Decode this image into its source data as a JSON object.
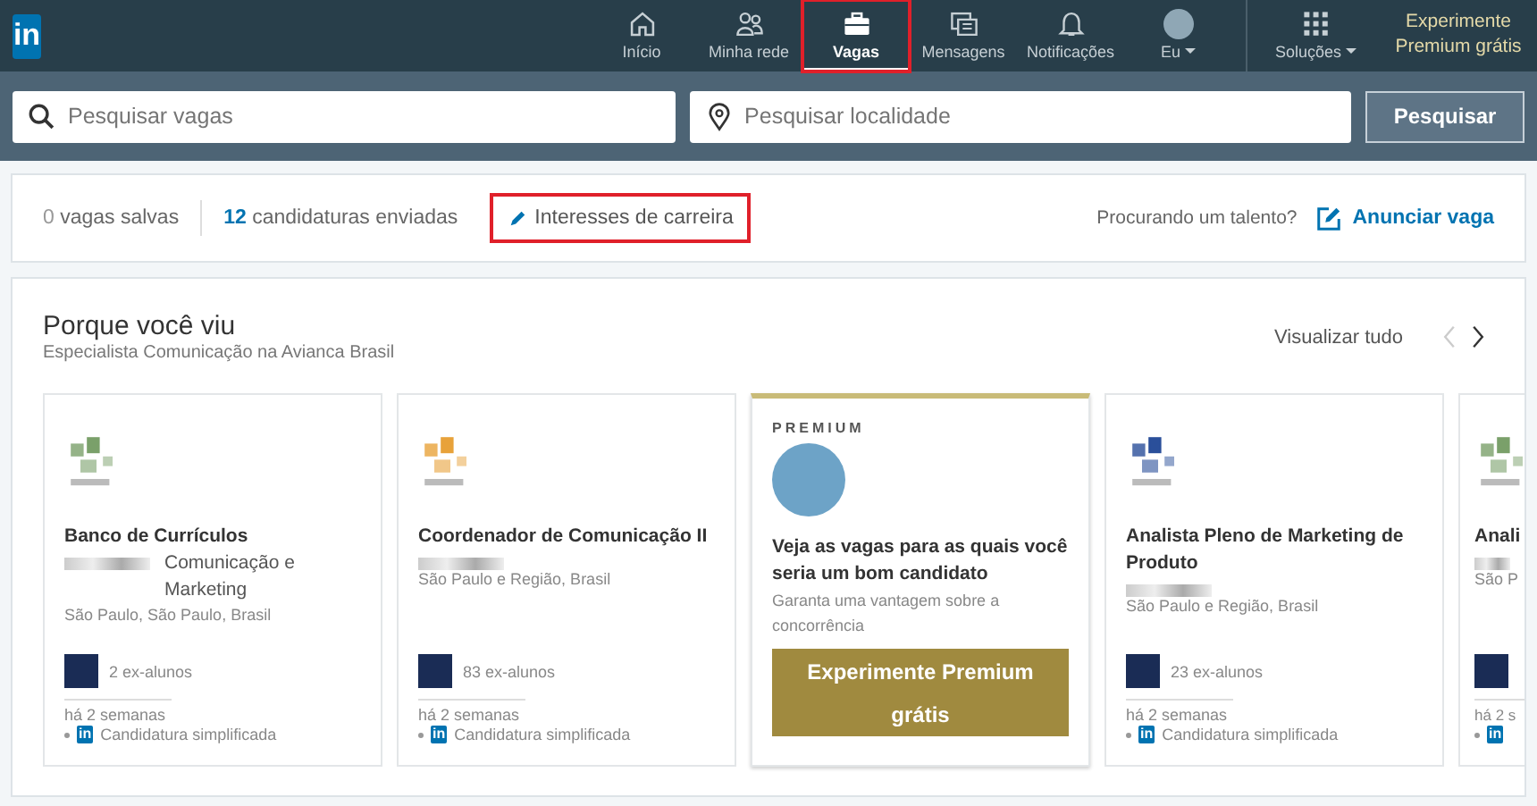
{
  "logo": {
    "text": "in"
  },
  "nav": [
    {
      "kind": "home",
      "label": "Início",
      "selected": false,
      "highlighted": false
    },
    {
      "kind": "network",
      "label": "Minha rede",
      "selected": false,
      "highlighted": false
    },
    {
      "kind": "jobs",
      "label": "Vagas",
      "selected": true,
      "highlighted": true
    },
    {
      "kind": "messages",
      "label": "Mensagens",
      "selected": false,
      "highlighted": false
    },
    {
      "kind": "bell",
      "label": "Notificações",
      "selected": false,
      "highlighted": false
    },
    {
      "kind": "avatar",
      "label": "Eu",
      "selected": false,
      "highlighted": false
    },
    {
      "kind": "grid",
      "label": "Soluções",
      "selected": false,
      "highlighted": false
    }
  ],
  "premium_link": "Experimente Premium grátis",
  "search": {
    "job_placeholder": "Pesquisar vagas",
    "location_placeholder": "Pesquisar localidade",
    "button": "Pesquisar"
  },
  "stats": {
    "saved_count": "0",
    "saved_label": "vagas salvas",
    "applied_count": "12",
    "applied_label": "candidaturas enviadas",
    "interests": "Interesses de carreira",
    "interests_highlighted": true,
    "talent_prompt": "Procurando um talento?",
    "post_job": "Anunciar vaga"
  },
  "section": {
    "title": "Porque você viu",
    "subtitle": "Especialista Comunicação na Avianca Brasil",
    "view_all": "Visualizar tudo"
  },
  "cards": [
    {
      "kind": "job",
      "title": "Banco de Currículos",
      "company": "Comunicação e Marketing",
      "location": "São Paulo, São Paulo, Brasil",
      "alumni": "2 ex-alunos",
      "posted": "há 2 semanas",
      "badge": "in",
      "apply": "Candidatura simplificada"
    },
    {
      "kind": "job",
      "title": "Coordenador de Comunicação II",
      "location": "São Paulo e Região, Brasil",
      "alumni": "83 ex-alunos",
      "posted": "há 2 semanas",
      "badge": "in",
      "apply": "Candidatura simplificada"
    },
    {
      "kind": "premium",
      "eyebrow": "PREMIUM",
      "title": "Veja as vagas para as quais você seria um bom candidato",
      "text": "Garanta uma vantagem sobre a concorrência",
      "button": "Experimente Premium grátis"
    },
    {
      "kind": "job",
      "title": "Analista Pleno de Marketing de Produto",
      "location": "São Paulo e Região, Brasil",
      "alumni": "23 ex-alunos",
      "posted": "há 2 semanas",
      "badge": "in",
      "apply": "Candidatura simplificada"
    },
    {
      "kind": "partial",
      "title": "Anali",
      "location": "São P",
      "posted": "há 2 s",
      "badge": "in"
    }
  ]
}
